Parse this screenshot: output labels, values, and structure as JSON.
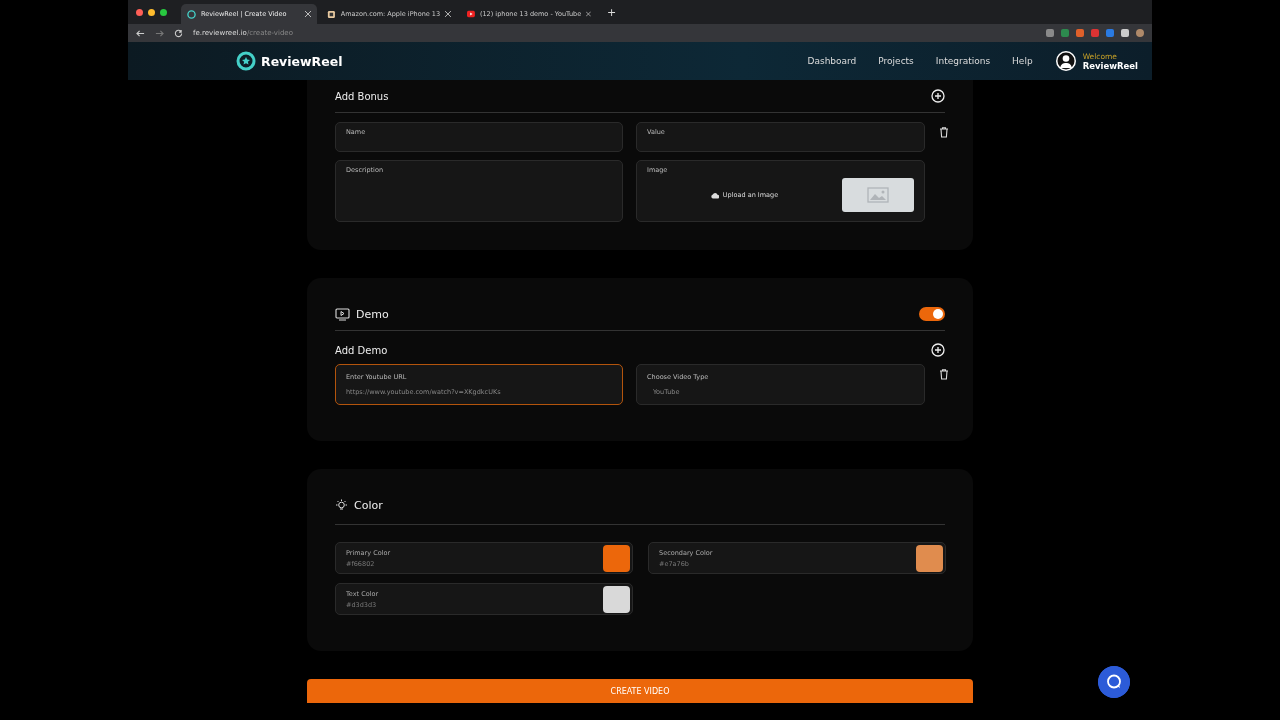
{
  "browser": {
    "tabs": [
      {
        "title": "ReviewReel | Create Video",
        "selected": true,
        "kind": "app"
      },
      {
        "title": "Amazon.com: Apple iPhone 13",
        "selected": false,
        "kind": "amazon"
      },
      {
        "title": "(12) iphone 13 demo - YouTube",
        "selected": false,
        "kind": "youtube"
      }
    ],
    "new_tab": "+",
    "url_host": "fe.reviewreel.io",
    "url_path": "/create-video"
  },
  "header": {
    "logo": "ReviewReel",
    "nav": [
      "Dashboard",
      "Projects",
      "Integrations",
      "Help"
    ],
    "welcome": "Welcome",
    "user": "ReviewReel"
  },
  "bonus": {
    "title": "Add Bonus",
    "fields": [
      {
        "label": "Name",
        "kind": "text"
      },
      {
        "label": "Value",
        "kind": "text"
      },
      {
        "label": "Description",
        "kind": "area"
      },
      {
        "label": "Image",
        "kind": "image",
        "upload": "Upload an Image"
      }
    ]
  },
  "demo": {
    "title": "Demo",
    "enabled": true,
    "add_title": "Add Demo",
    "url": {
      "label": "Enter Youtube URL",
      "value": "https://www.youtube.com/watch?v=XKgdkcUKs"
    },
    "type": {
      "label": "Choose Video Type",
      "value": "YouTube"
    }
  },
  "color": {
    "title": "Color",
    "colors": [
      {
        "label": "Primary Color",
        "value": "#f66802",
        "color": "#ec670b"
      },
      {
        "label": "Secondary Color",
        "value": "#e7a76b",
        "color": "#e08c4e"
      },
      {
        "label": "Text Color",
        "value": "#d3d3d3",
        "color": "#d9d9d9"
      }
    ]
  },
  "submit": "CREATE VIDEO"
}
